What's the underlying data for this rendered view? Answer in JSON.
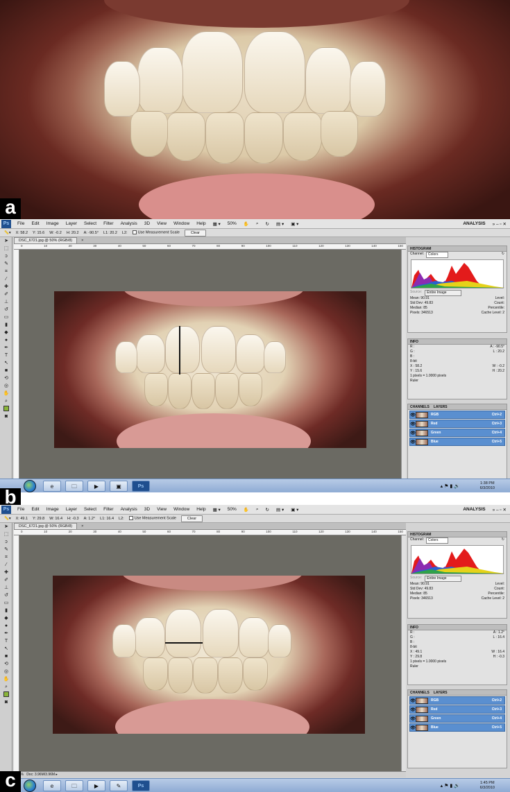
{
  "panel_labels": {
    "a": "a",
    "b": "b",
    "c": "c"
  },
  "menu": [
    "File",
    "Edit",
    "Image",
    "Layer",
    "Select",
    "Filter",
    "Analysis",
    "3D",
    "View",
    "Window",
    "Help"
  ],
  "app_logo": "Ps",
  "zoom_menu": "50%",
  "workspace": "ANALYSIS",
  "document_tab": "DSC_6721.jpg @ 50% (RGB/8)",
  "use_measurement_scale": "Use Measurement Scale",
  "clear_button": "Clear",
  "status_doc": "Doc: 3.96M/3.96M",
  "status_zoom": "50%",
  "ruler_ticks": [
    "0",
    "10",
    "20",
    "30",
    "40",
    "50",
    "60",
    "70",
    "80",
    "90",
    "100",
    "110",
    "120",
    "130",
    "140",
    "150"
  ],
  "histogram": {
    "tab": "HISTOGRAM",
    "channel_label": "Channel:",
    "channel_value": "Colors",
    "source_label": "Source:",
    "source_value": "Entire Image",
    "stats": [
      [
        "Mean:",
        "90.91",
        "Level:",
        ""
      ],
      [
        "Std Dev:",
        "49.83",
        "Count:",
        ""
      ],
      [
        "Median:",
        "85",
        "Percentile:",
        ""
      ],
      [
        "Pixels:",
        "346513",
        "Cache Level:",
        "2"
      ]
    ]
  },
  "channels": {
    "tabs": [
      "CHANNELS",
      "LAYERS"
    ],
    "items": [
      {
        "name": "RGB",
        "shortcut": "Ctrl+2"
      },
      {
        "name": "Red",
        "shortcut": "Ctrl+3"
      },
      {
        "name": "Green",
        "shortcut": "Ctrl+4"
      },
      {
        "name": "Blue",
        "shortcut": "Ctrl+5"
      }
    ]
  },
  "screen_b": {
    "options": {
      "x": "X: 58.2",
      "y": "Y: 15.6",
      "w": "W: -0.2",
      "h": "H: 20.2",
      "a": "A: -90.5°",
      "l1": "L1: 20.2",
      "l2": "L2:"
    },
    "info": {
      "tab": "INFO",
      "r": "R :",
      "g": "G :",
      "b": "B :",
      "a_label": "A :",
      "a_value": "-90.5°",
      "l_label": "L :",
      "l_value": "20.2",
      "bit": "8-bit",
      "x_label": "X :",
      "x_value": "58.2",
      "y_label": "Y :",
      "y_value": "15.6",
      "w_label": "W :",
      "w_value": "-0.2",
      "h_label": "H :",
      "h_value": "20.2",
      "scale": "1 pixels = 1.0000 pixels",
      "ruler": "Ruler"
    },
    "taskbar": {
      "time": "1:38 PM",
      "date": "6/3/2010"
    }
  },
  "screen_c": {
    "options": {
      "x": "X: 49.1",
      "y": "Y: 29.8",
      "w": "W: 16.4",
      "h": "H: -0.3",
      "a": "A: 1.2°",
      "l1": "L1: 16.4",
      "l2": "L2:"
    },
    "info": {
      "tab": "INFO",
      "r": "R :",
      "g": "G :",
      "b": "B :",
      "a_label": "A :",
      "a_value": "1.2°",
      "l_label": "L :",
      "l_value": "16.4",
      "bit": "8-bit",
      "x_label": "X :",
      "x_value": "49.1",
      "y_label": "Y :",
      "y_value": "29.8",
      "w_label": "W :",
      "w_value": "16.4",
      "h_label": "H :",
      "h_value": "-0.3",
      "scale": "1 pixels = 1.0000 pixels",
      "ruler": "Ruler"
    },
    "taskbar": {
      "time": "1:45 PM",
      "date": "6/3/2010"
    }
  }
}
